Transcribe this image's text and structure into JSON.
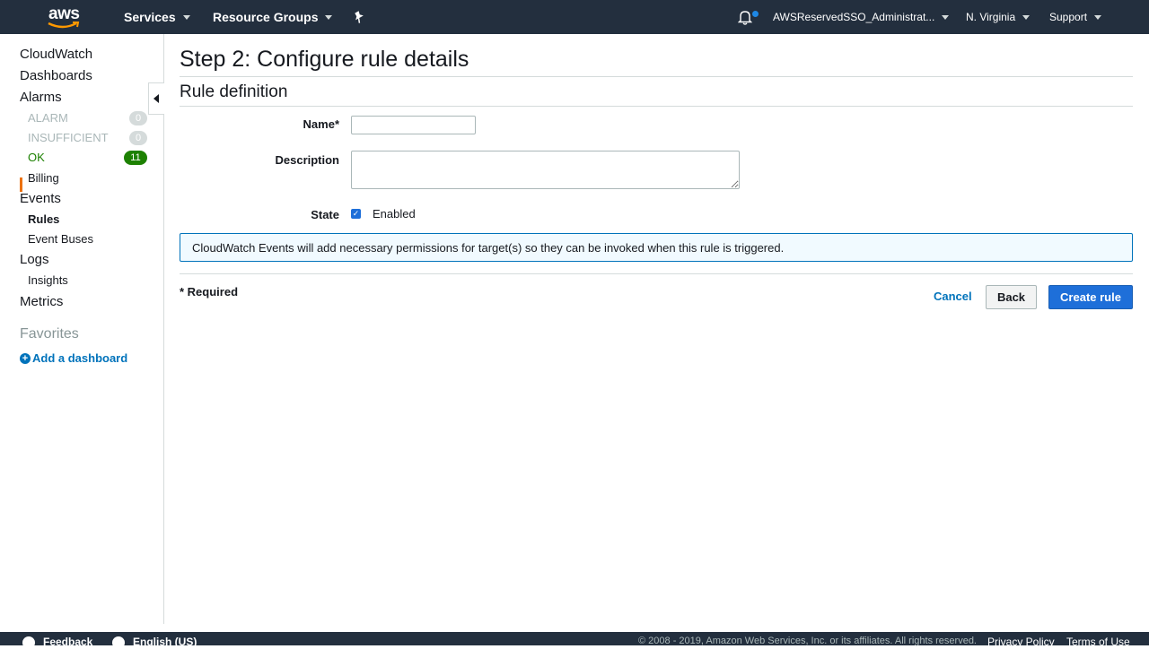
{
  "topnav": {
    "logo_text": "aws",
    "services": "Services",
    "resource_groups": "Resource Groups",
    "account": "AWSReservedSSO_Administrat...",
    "region": "N. Virginia",
    "support": "Support"
  },
  "sidebar": {
    "cloudwatch": "CloudWatch",
    "dashboards": "Dashboards",
    "alarms": "Alarms",
    "alarm": {
      "label": "ALARM",
      "count": "0"
    },
    "insufficient": {
      "label": "INSUFFICIENT",
      "count": "0"
    },
    "ok": {
      "label": "OK",
      "count": "11"
    },
    "billing": "Billing",
    "events": "Events",
    "rules": "Rules",
    "event_buses": "Event Buses",
    "logs": "Logs",
    "insights": "Insights",
    "metrics": "Metrics",
    "favorites": "Favorites",
    "add_dashboard": "Add a dashboard"
  },
  "main": {
    "title": "Step 2: Configure rule details",
    "section": "Rule definition",
    "name_label": "Name*",
    "name_value": "",
    "description_label": "Description",
    "description_value": "",
    "state_label": "State",
    "state_checked": true,
    "state_option": "Enabled",
    "info": "CloudWatch Events will add necessary permissions for target(s) so they can be invoked when this rule is triggered.",
    "required": "* Required",
    "cancel": "Cancel",
    "back": "Back",
    "create": "Create rule"
  },
  "footer": {
    "feedback": "Feedback",
    "language": "English (US)",
    "copyright": "© 2008 - 2019, Amazon Web Services, Inc. or its affiliates. All rights reserved.",
    "privacy": "Privacy Policy",
    "terms": "Terms of Use"
  },
  "colors": {
    "nav_bg": "#232f3e",
    "link": "#0073bb",
    "primary": "#1e6fd9",
    "ok_green": "#1d8102",
    "active_marker": "#ec7211",
    "info_bg": "#f1faff"
  },
  "icons": [
    "aws-smile-icon",
    "pin-icon",
    "bell-icon",
    "add-circle-icon",
    "collapse-left-icon",
    "checkmark-icon",
    "feedback-icon",
    "globe-icon"
  ]
}
